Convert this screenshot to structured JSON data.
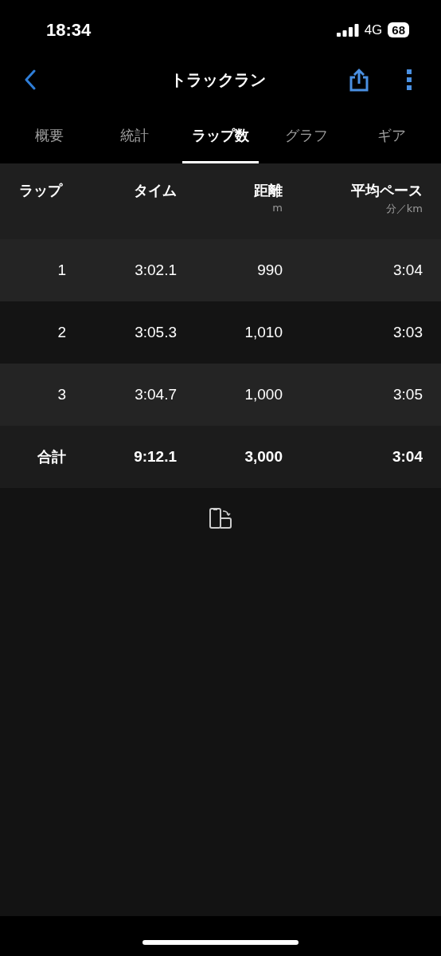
{
  "status_bar": {
    "time": "18:34",
    "network": "4G",
    "battery": "68"
  },
  "nav": {
    "title": "トラックラン"
  },
  "tabs": [
    {
      "label": "概要",
      "selected": false
    },
    {
      "label": "統計",
      "selected": false
    },
    {
      "label": "ラップ数",
      "selected": true
    },
    {
      "label": "グラフ",
      "selected": false
    },
    {
      "label": "ギア",
      "selected": false
    }
  ],
  "table": {
    "columns": [
      {
        "label": "ラップ"
      },
      {
        "label": "タイム"
      },
      {
        "label": "距離",
        "unit": "m"
      },
      {
        "label": "平均ペース",
        "unit": "分／km"
      }
    ],
    "rows": [
      {
        "kind": "lap",
        "cells": [
          "1",
          "3:02.1",
          "990",
          "3:04"
        ]
      },
      {
        "kind": "lap",
        "cells": [
          "2",
          "3:05.3",
          "1,010",
          "3:03"
        ]
      },
      {
        "kind": "lap",
        "cells": [
          "3",
          "3:04.7",
          "1,000",
          "3:05"
        ]
      },
      {
        "kind": "total",
        "cells": [
          "合計",
          "9:12.1",
          "3,000",
          "3:04"
        ]
      }
    ]
  }
}
